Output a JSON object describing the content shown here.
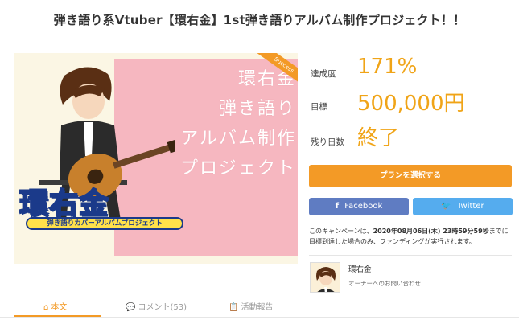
{
  "project": {
    "title": "弾き語り系Vtuber【環右金】1st弾き語りアルバム制作プロジェクト！！"
  },
  "hero": {
    "headline_lines": [
      "環右金",
      "弾き語り",
      "アルバム制作",
      "プロジェクト"
    ],
    "ribbon": "Success",
    "logo_text": "環右金",
    "logo_subtitle": "弾き語りカバーアルバムプロジェクト"
  },
  "stats": {
    "achievement_label": "達成度",
    "achievement_value": "171%",
    "goal_label": "目標",
    "goal_value": "500,000円",
    "remaining_label": "残り日数",
    "remaining_value": "終了"
  },
  "actions": {
    "select_plan": "プランを選択する",
    "facebook_icon": "f",
    "facebook": "Facebook",
    "twitter_icon": "🐦",
    "twitter": "Twitter"
  },
  "notice": {
    "prefix": "このキャンペーンは、",
    "deadline": "2020年08月06日(木) 23時59分59秒",
    "suffix": "までに目標到達した場合のみ、ファンディングが実行されます。"
  },
  "owner": {
    "name": "環右金",
    "contact": "オーナーへのお問い合わせ"
  },
  "tabs": [
    {
      "icon": "⌂",
      "label": "本文"
    },
    {
      "icon": "💬",
      "label": "コメント(53)"
    },
    {
      "icon": "📋",
      "label": "活動報告"
    }
  ],
  "colors": {
    "accent": "#f39a26",
    "stat_value": "#f0a417",
    "facebook": "#5f7cc2",
    "twitter": "#55acee",
    "hero_pink": "#f6b7c0"
  }
}
